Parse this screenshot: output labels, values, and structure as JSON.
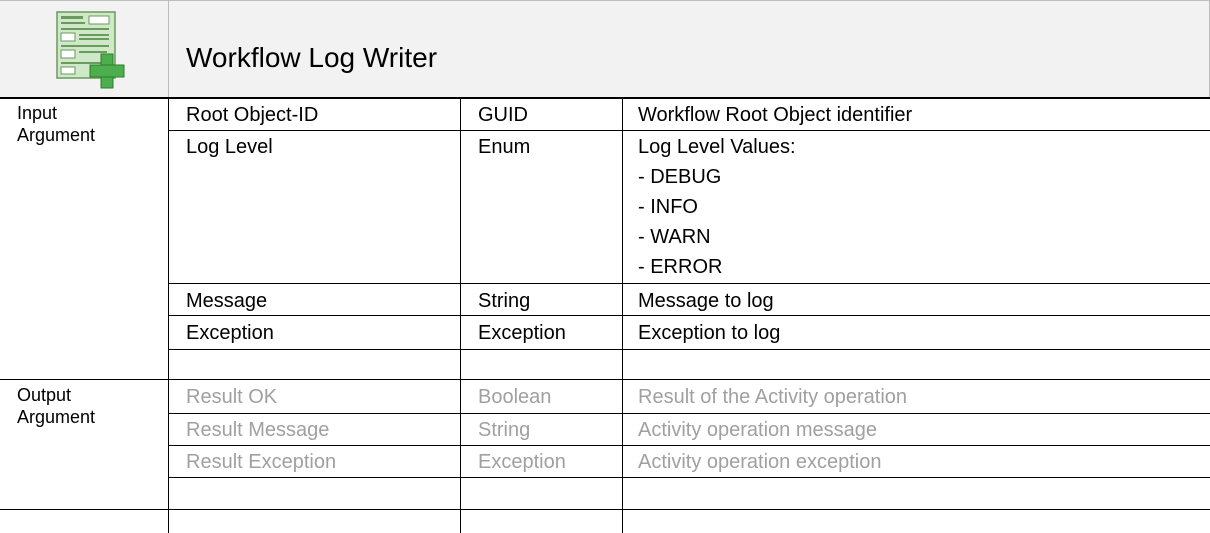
{
  "header": {
    "title": "Workflow Log Writer",
    "logo_icon": "workflow-form-add-icon"
  },
  "input_section": {
    "label_line1": "Input",
    "label_line2": "Argument",
    "rows": [
      {
        "name": "Root Object-ID",
        "type": "GUID",
        "description": [
          "Workflow Root Object identifier"
        ]
      },
      {
        "name": "Log Level",
        "type": "Enum",
        "description": [
          "Log Level Values:",
          "- DEBUG",
          "- INFO",
          "- WARN",
          "- ERROR"
        ]
      },
      {
        "name": "Message",
        "type": "String",
        "description": [
          "Message to log"
        ]
      },
      {
        "name": "Exception",
        "type": "Exception",
        "description": [
          "Exception to log"
        ]
      }
    ]
  },
  "output_section": {
    "label_line1": "Output",
    "label_line2": "Argument",
    "rows": [
      {
        "name": "Result OK",
        "type": "Boolean",
        "description": "Result of the Activity operation"
      },
      {
        "name": "Result Message",
        "type": "String",
        "description": "Activity operation message"
      },
      {
        "name": "Result Exception",
        "type": "Exception",
        "description": "Activity operation exception"
      }
    ]
  },
  "colors": {
    "header_bg": "#f2f2f2",
    "disabled_text": "#a0a0a0",
    "logo_green": "#5cb85c"
  }
}
